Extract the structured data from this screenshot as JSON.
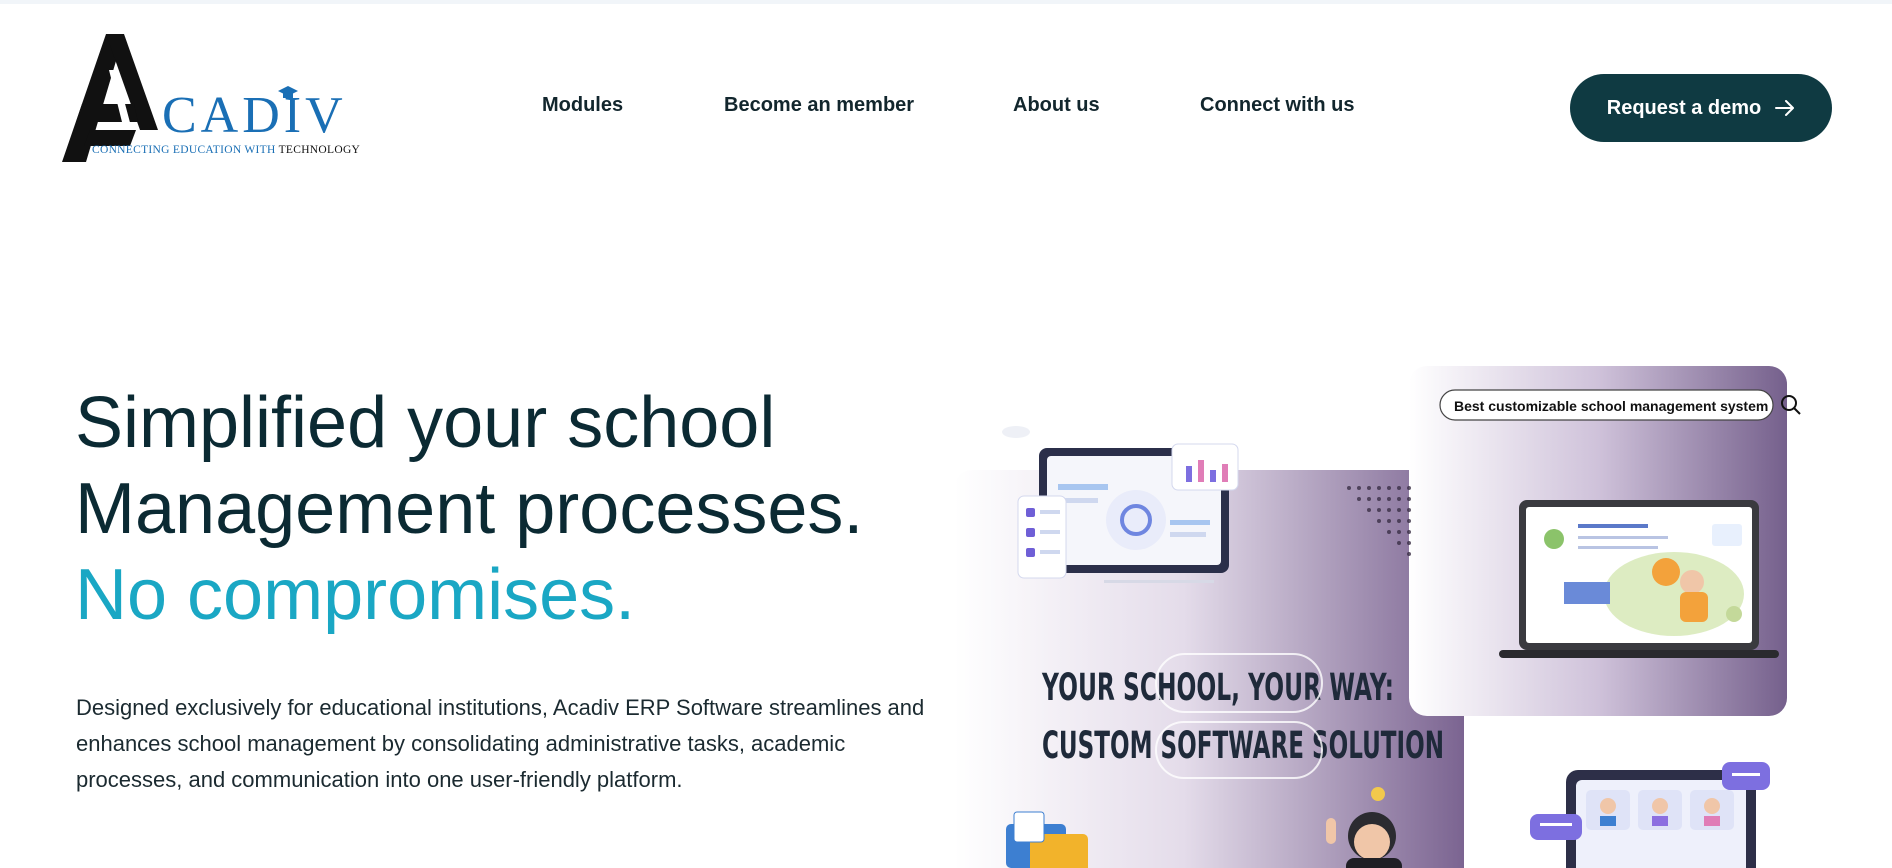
{
  "brand": {
    "wordmark": "CADIV",
    "tagline_blue": "CONNECTING EDUCATION WITH",
    "tagline_dark": "TECHNOLOGY"
  },
  "nav": {
    "items": [
      {
        "label": "Modules"
      },
      {
        "label": "Become an member"
      },
      {
        "label": "About us"
      },
      {
        "label": "Connect with us"
      }
    ],
    "cta_label": "Request a demo"
  },
  "hero": {
    "title_line1": "Simplified your school",
    "title_line2": "Management processes.",
    "title_accent": "No compromises.",
    "description": "Designed exclusively for educational institutions, Acadiv ERP Software streamlines and enhances school management by consolidating administrative tasks, academic processes, and communication into one user-friendly platform."
  },
  "illustration": {
    "search_text": "Best customizable school management system",
    "headline_line1": "YOUR SCHOOL, YOUR WAY:",
    "headline_line2": "CUSTOM SOFTWARE SOLUTION"
  },
  "colors": {
    "primary_dark": "#0f3a42",
    "accent_teal": "#1aa7c4",
    "brand_blue": "#1a6fb5",
    "illustration_purple": "#7b6491"
  }
}
